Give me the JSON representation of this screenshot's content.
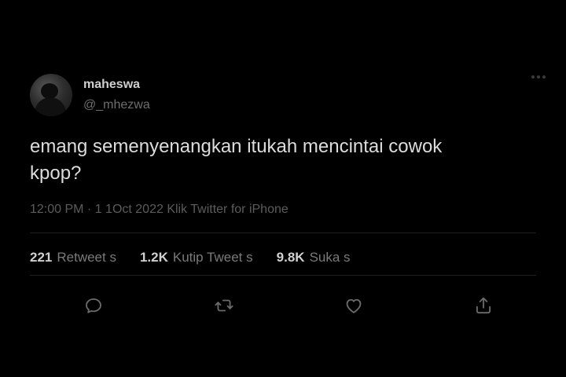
{
  "user": {
    "display_name": "maheswa",
    "handle": "@_mhezwa"
  },
  "tweet": {
    "text": "emang semenyenangkan itukah mencintai cowok\nkpop?",
    "meta": "12:00 PM · 1 1Oct 2022 Klik Twitter for iPhone"
  },
  "stats": [
    {
      "count": "221",
      "label": "Retweet s"
    },
    {
      "count": "1.2K",
      "label": "Kutip  Tweet s"
    },
    {
      "count": "9.8K",
      "label": "Suka s"
    }
  ],
  "actions": {
    "reply_icon": "reply-icon",
    "retweet_icon": "retweet-icon",
    "like_icon": "heart-icon",
    "share_icon": "share-icon"
  },
  "colors": {
    "background": "#000000",
    "text": "#dcdcdc",
    "muted": "#6e6e6e",
    "icon": "#6b6b6b"
  }
}
